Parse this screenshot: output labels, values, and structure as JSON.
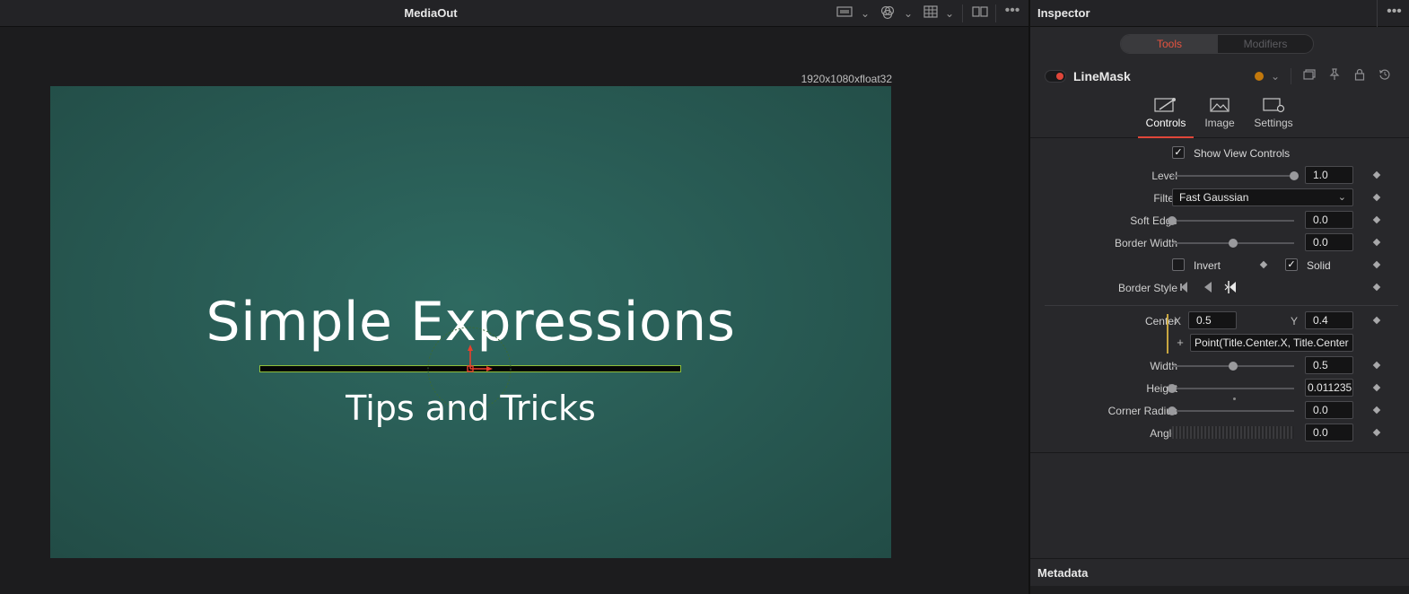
{
  "viewer": {
    "title": "MediaOut",
    "resolution": "1920x1080xfloat32",
    "canvas_title": "Simple Expressions",
    "canvas_subtitle": "Tips and Tricks",
    "icons": [
      "display-icon",
      "chevron-down-icon",
      "color-icon",
      "chevron-down-icon",
      "grid-icon",
      "chevron-down-icon",
      "split-view-icon",
      "more-icon"
    ]
  },
  "inspector": {
    "title": "Inspector",
    "segment": {
      "tools": "Tools",
      "modifiers": "Modifiers",
      "active_color": "#e8533f"
    },
    "tool_name": "LineMask",
    "tool_color": "#c2780c",
    "tabs": [
      {
        "label": "Controls",
        "active": true
      },
      {
        "label": "Image",
        "active": false
      },
      {
        "label": "Settings",
        "active": false
      }
    ],
    "controls": {
      "show_view_controls": {
        "label": "Show View Controls",
        "checked": true
      },
      "level": {
        "label": "Level",
        "value": "1.0",
        "slider": 1.0
      },
      "filter": {
        "label": "Filter",
        "value": "Fast Gaussian"
      },
      "soft_edge": {
        "label": "Soft Edge",
        "value": "0.0",
        "slider": 0.0
      },
      "border_width": {
        "label": "Border Width",
        "value": "0.0",
        "slider": 0.5
      },
      "invert": {
        "label": "Invert",
        "checked": false
      },
      "solid": {
        "label": "Solid",
        "checked": true
      },
      "border_style": {
        "label": "Border Style"
      },
      "center": {
        "label": "Center",
        "x_label": "X",
        "x": "0.5",
        "y_label": "Y",
        "y": "0.4",
        "expression": "Point(Title.Center.X, Title.Center"
      },
      "width": {
        "label": "Width",
        "value": "0.5",
        "slider": 0.5
      },
      "height": {
        "label": "Height",
        "value": "0.011235",
        "slider": 0.0
      },
      "corner_radius": {
        "label": "Corner Radius",
        "value": "0.0",
        "slider": 0.0
      },
      "angle": {
        "label": "Angle",
        "value": "0.0"
      }
    },
    "metadata_title": "Metadata"
  }
}
